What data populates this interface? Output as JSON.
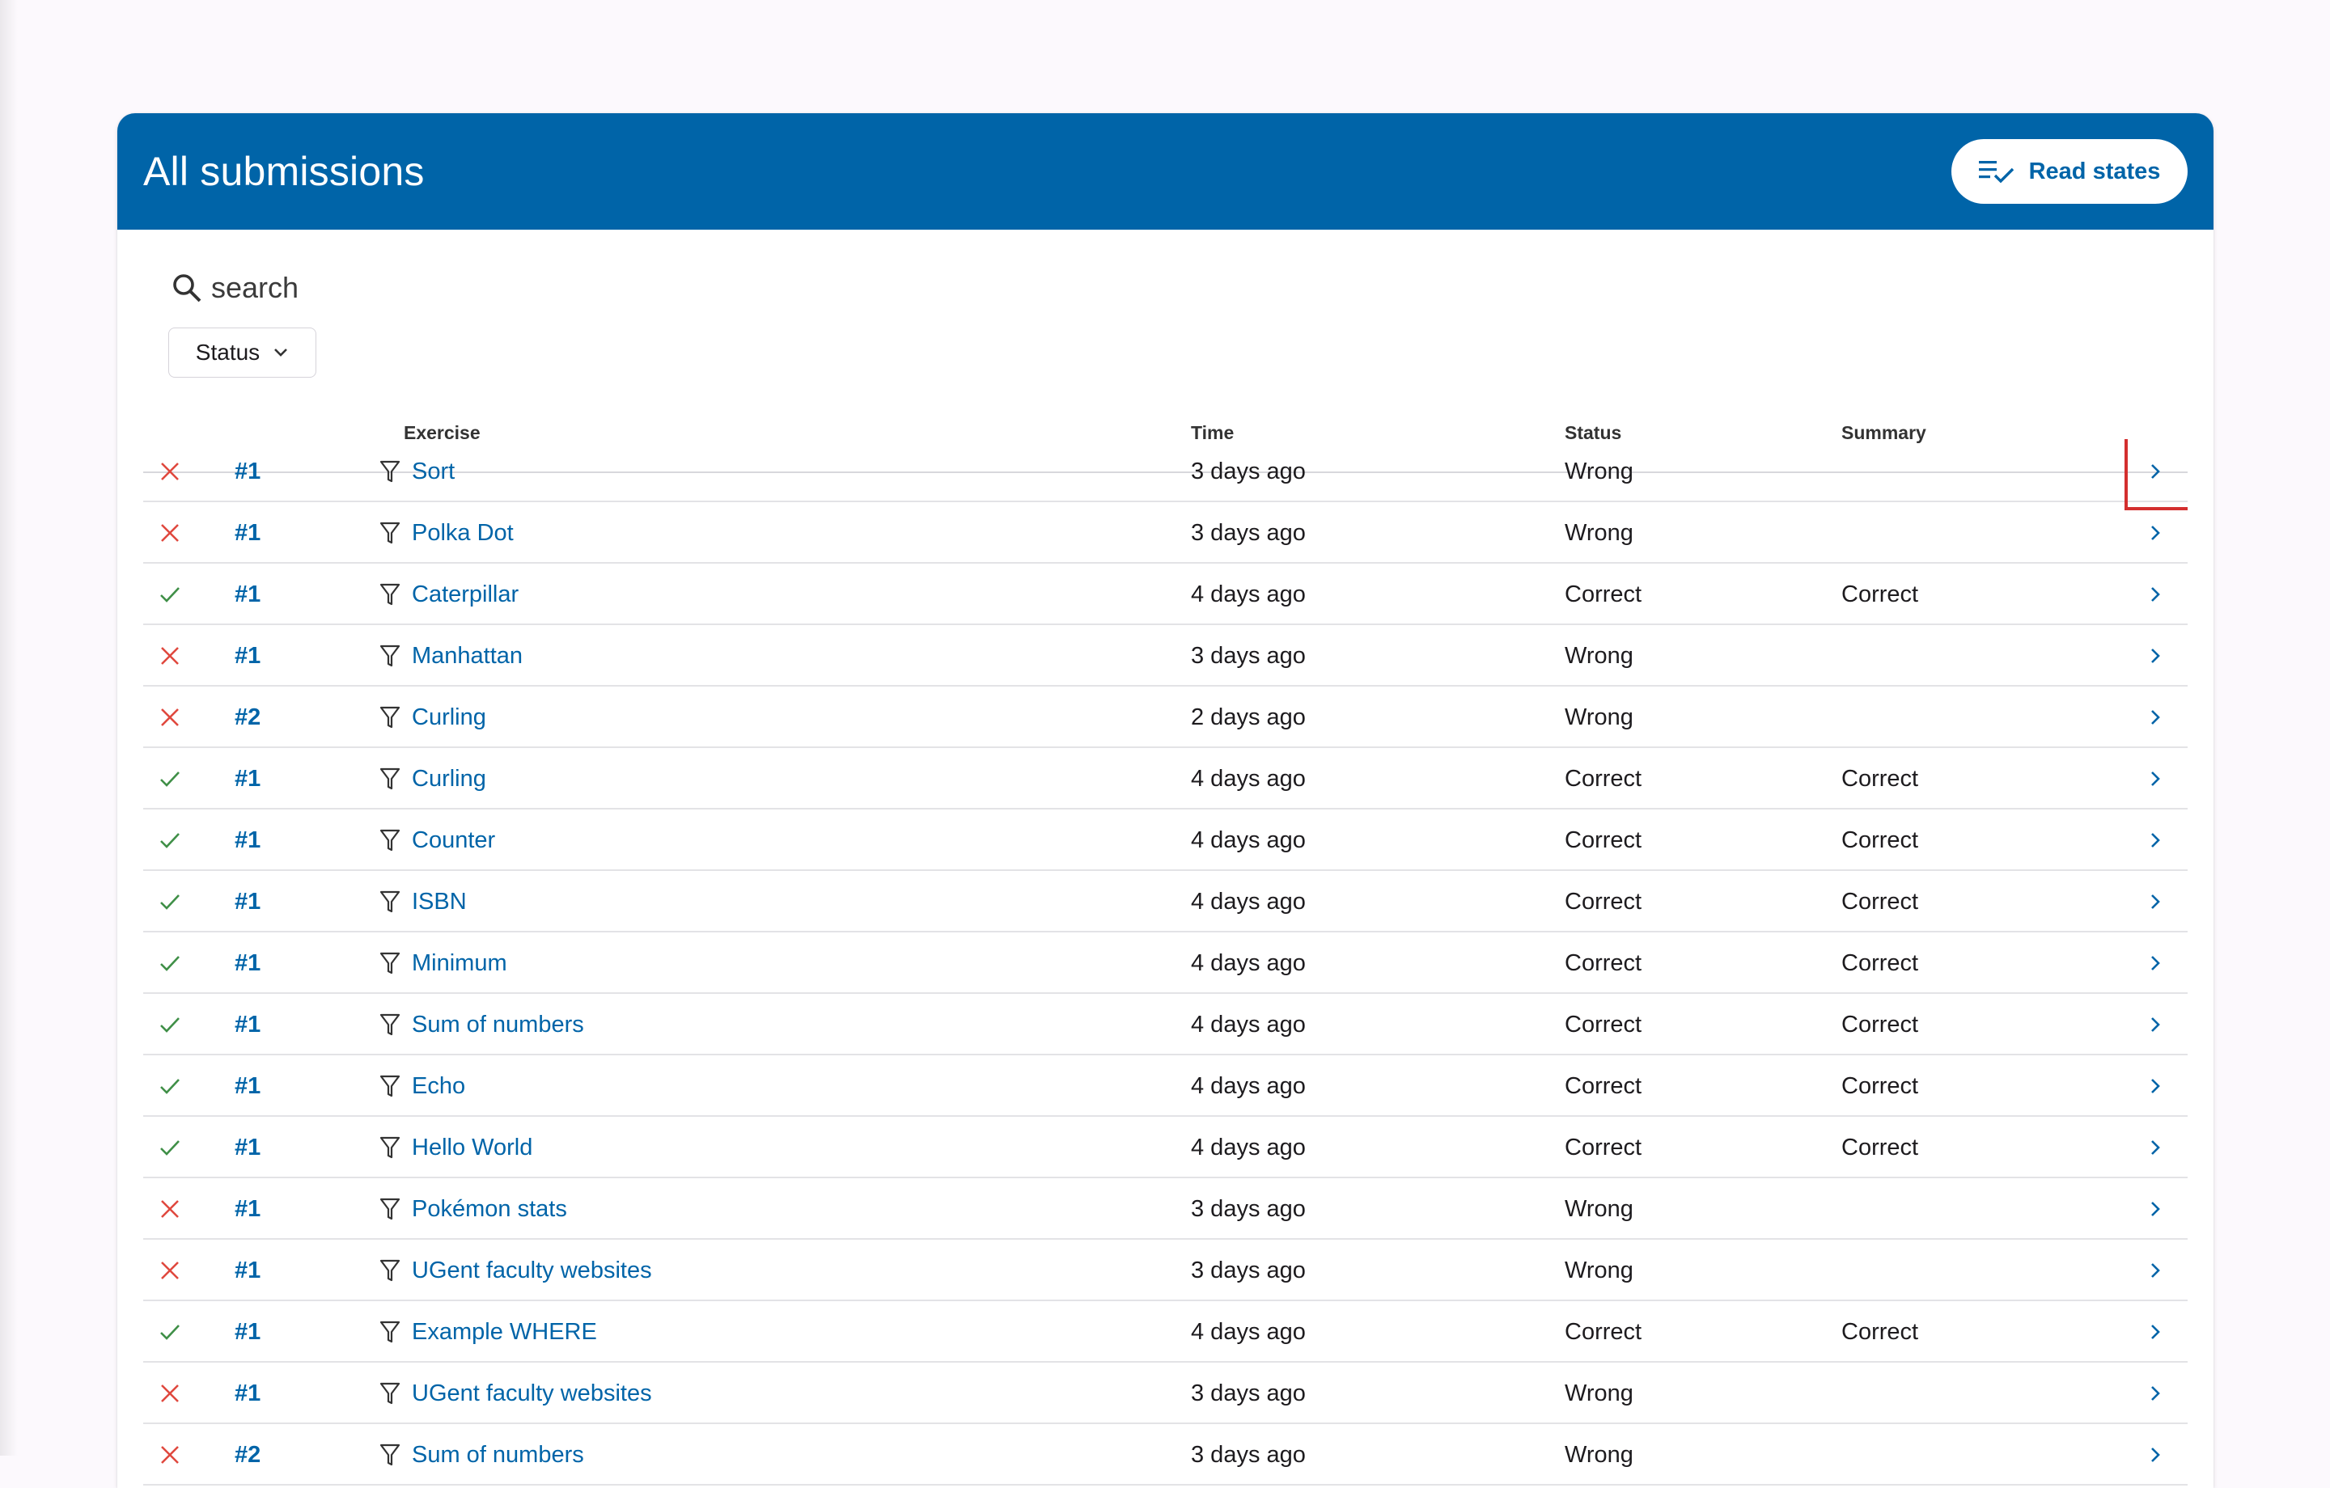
{
  "header": {
    "title": "All submissions",
    "read_states_label": "Read states"
  },
  "search": {
    "placeholder": "search"
  },
  "filter": {
    "status_label": "Status"
  },
  "columns": {
    "exercise": "Exercise",
    "time": "Time",
    "status": "Status",
    "summary": "Summary"
  },
  "colors": {
    "brand": "#0064a8",
    "correct": "#3f8f47",
    "wrong": "#e0483e",
    "focus": "#d32f2f"
  },
  "rows": [
    {
      "result": "wrong",
      "number": "#1",
      "exercise": "Sort",
      "time": "3 days ago",
      "status": "Wrong",
      "summary": ""
    },
    {
      "result": "wrong",
      "number": "#1",
      "exercise": "Polka Dot",
      "time": "3 days ago",
      "status": "Wrong",
      "summary": ""
    },
    {
      "result": "correct",
      "number": "#1",
      "exercise": "Caterpillar",
      "time": "4 days ago",
      "status": "Correct",
      "summary": "Correct"
    },
    {
      "result": "wrong",
      "number": "#1",
      "exercise": "Manhattan",
      "time": "3 days ago",
      "status": "Wrong",
      "summary": ""
    },
    {
      "result": "wrong",
      "number": "#2",
      "exercise": "Curling",
      "time": "2 days ago",
      "status": "Wrong",
      "summary": ""
    },
    {
      "result": "correct",
      "number": "#1",
      "exercise": "Curling",
      "time": "4 days ago",
      "status": "Correct",
      "summary": "Correct"
    },
    {
      "result": "correct",
      "number": "#1",
      "exercise": "Counter",
      "time": "4 days ago",
      "status": "Correct",
      "summary": "Correct"
    },
    {
      "result": "correct",
      "number": "#1",
      "exercise": "ISBN",
      "time": "4 days ago",
      "status": "Correct",
      "summary": "Correct"
    },
    {
      "result": "correct",
      "number": "#1",
      "exercise": "Minimum",
      "time": "4 days ago",
      "status": "Correct",
      "summary": "Correct"
    },
    {
      "result": "correct",
      "number": "#1",
      "exercise": "Sum of numbers",
      "time": "4 days ago",
      "status": "Correct",
      "summary": "Correct"
    },
    {
      "result": "correct",
      "number": "#1",
      "exercise": "Echo",
      "time": "4 days ago",
      "status": "Correct",
      "summary": "Correct"
    },
    {
      "result": "correct",
      "number": "#1",
      "exercise": "Hello World",
      "time": "4 days ago",
      "status": "Correct",
      "summary": "Correct"
    },
    {
      "result": "wrong",
      "number": "#1",
      "exercise": "Pokémon stats",
      "time": "3 days ago",
      "status": "Wrong",
      "summary": ""
    },
    {
      "result": "wrong",
      "number": "#1",
      "exercise": "UGent faculty websites",
      "time": "3 days ago",
      "status": "Wrong",
      "summary": ""
    },
    {
      "result": "correct",
      "number": "#1",
      "exercise": "Example WHERE",
      "time": "4 days ago",
      "status": "Correct",
      "summary": "Correct"
    },
    {
      "result": "wrong",
      "number": "#1",
      "exercise": "UGent faculty websites",
      "time": "3 days ago",
      "status": "Wrong",
      "summary": ""
    },
    {
      "result": "wrong",
      "number": "#2",
      "exercise": "Sum of numbers",
      "time": "3 days ago",
      "status": "Wrong",
      "summary": ""
    }
  ]
}
